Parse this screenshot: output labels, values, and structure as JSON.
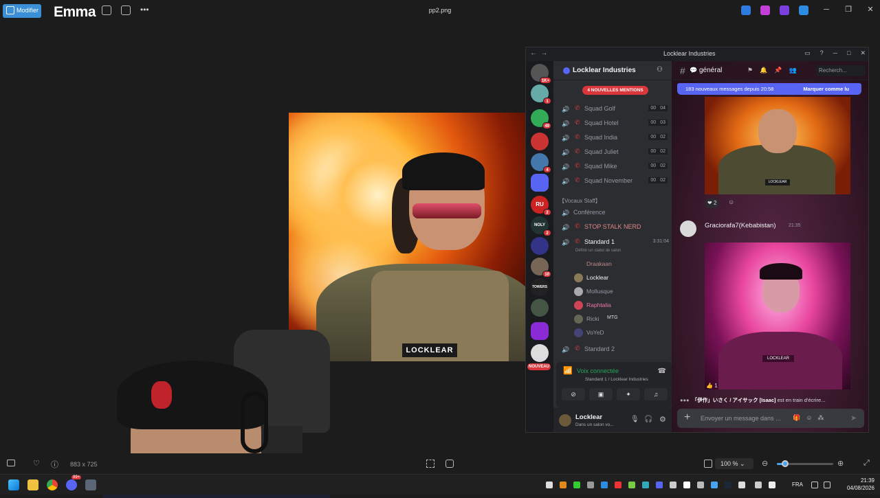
{
  "viewer": {
    "edit_label": "Modifier",
    "brand": "Emma",
    "filename": "pp2.png",
    "dimensions": "883 x 725",
    "zoom": "100 %",
    "zoom_level": 0.15
  },
  "main_image": {
    "patch_text": "LOCKLEAR"
  },
  "discord": {
    "window_title": "Locklear Industries",
    "server_name": "Locklear Industries",
    "mentions_pill": "4 NOUVELLES MENTIONS",
    "guild_badges": [
      "1K+",
      "1",
      "49",
      "4",
      "2",
      "2",
      "10"
    ],
    "guild_labels": [
      "RU",
      "NOLY",
      "TOWERS"
    ],
    "nouveau_label": "NOUVEAU",
    "channels": [
      {
        "name": "Squad Golf",
        "c1": "00",
        "c2": "04"
      },
      {
        "name": "Squad Hotel",
        "c1": "00",
        "c2": "03"
      },
      {
        "name": "Squad India",
        "c1": "00",
        "c2": "02"
      },
      {
        "name": "Squad Juliet",
        "c1": "00",
        "c2": "02"
      },
      {
        "name": "Squad Mike",
        "c1": "00",
        "c2": "02"
      },
      {
        "name": "Squad November",
        "c1": "00",
        "c2": "02"
      }
    ],
    "category_staff": "【Vocaux Staff】",
    "conference": "Conférence",
    "stop_stalk": "STOP STALK NERD",
    "standard1": "Standard 1",
    "standard1_time": "3:31:04",
    "status_hint": "Définir un statut de salon",
    "members": [
      "Draakaan",
      "Locklear",
      "Mollusque",
      "Raphtalia",
      "Ricki",
      "VoYeD"
    ],
    "member_tag_ricki": "MTG",
    "standard2": "Standard 2",
    "voice_status": "Voix connectée",
    "voice_detail": "Standard 1 / Locklear Industries",
    "username": "Locklear",
    "user_status": "Dans un salon vo...",
    "channel_name": "général",
    "search_placeholder": "Recherch...",
    "new_messages": "183 nouveaux messages depuis 20:58",
    "mark_read": "Marquer comme lu",
    "reaction1": "2",
    "author": "Graciorafa7(Kebabistan)",
    "author_time": "21:35",
    "reaction2": "1",
    "typing_user": "「伊作」いさく / アイサック [Isaac]",
    "typing_text": "est en train d'écrire...",
    "input_placeholder": "Envoyer un message dans ...",
    "img_patch": "LOCKLEAR",
    "img2_text": "LOCKLEAR"
  },
  "taskbar": {
    "time": "21:39",
    "date": "04/08/2026",
    "lang": "FRA",
    "badge": "99+"
  }
}
